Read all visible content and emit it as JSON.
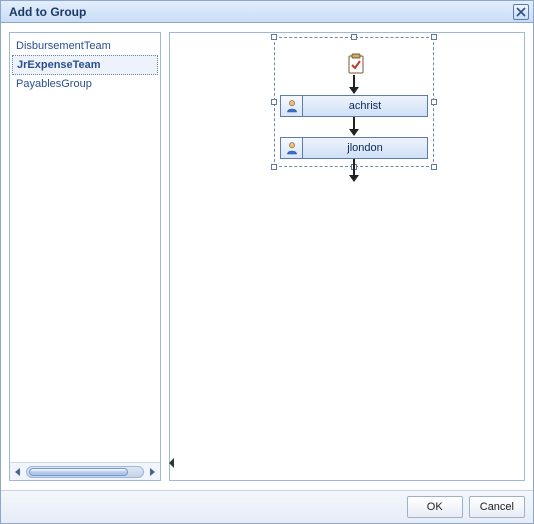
{
  "dialog": {
    "title": "Add to Group"
  },
  "sidebar": {
    "items": [
      {
        "label": "DisbursementTeam",
        "selected": false
      },
      {
        "label": "JrExpenseTeam",
        "selected": true
      },
      {
        "label": "PayablesGroup",
        "selected": false
      }
    ]
  },
  "flow": {
    "nodes": [
      {
        "label": "achrist"
      },
      {
        "label": "jlondon"
      }
    ]
  },
  "footer": {
    "ok_label": "OK",
    "cancel_label": "Cancel"
  },
  "icons": {
    "close": "close-icon",
    "start": "clipboard-check-icon",
    "user": "person-icon",
    "scroll_left": "triangle-left-icon",
    "scroll_right": "triangle-right-icon"
  },
  "colors": {
    "accent_border": "#5d7cad",
    "node_fill_top": "#eef4fc",
    "node_fill_bottom": "#cfe0f6",
    "link_text": "#2a4f8f"
  }
}
